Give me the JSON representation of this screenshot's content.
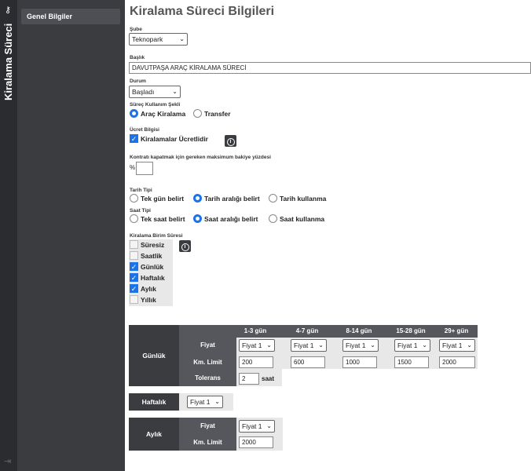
{
  "rail": {
    "title": "Kiralama Süreci"
  },
  "sidebar": {
    "items": [
      {
        "label": "Genel Bilgiler"
      }
    ]
  },
  "page": {
    "title": "Kiralama Süreci Bilgileri"
  },
  "sube": {
    "label": "Şube",
    "value": "Teknopark"
  },
  "baslik": {
    "label": "Başlık",
    "value": "DAVUTPAŞA ARAÇ KİRALAMA SÜRECİ"
  },
  "durum": {
    "label": "Durum",
    "value": "Başladı"
  },
  "kullanim": {
    "label": "Süreç Kullanım Şekli",
    "options": [
      "Araç Kiralama",
      "Transfer"
    ],
    "selected": "Araç Kiralama"
  },
  "ucret": {
    "label": "Ücret Bilgisi",
    "checkbox_label": "Kiralamalar Ücretlidir",
    "checked": true
  },
  "bakiye": {
    "label": "Kontratı kapatmak için gereken maksimum bakiye yüzdesi",
    "prefix": "%",
    "value": ""
  },
  "tarih": {
    "label": "Tarih Tipi",
    "options": [
      "Tek gün belirt",
      "Tarih aralığı belirt",
      "Tarih kullanma"
    ],
    "selected": "Tarih aralığı belirt"
  },
  "saat": {
    "label": "Saat Tipi",
    "options": [
      "Tek saat belirt",
      "Saat aralığı belirt",
      "Saat kullanma"
    ],
    "selected": "Saat aralığı belirt"
  },
  "birim": {
    "label": "Kiralama Birim Süresi",
    "items": [
      {
        "label": "Süresiz",
        "checked": false
      },
      {
        "label": "Saatlik",
        "checked": false
      },
      {
        "label": "Günlük",
        "checked": true
      },
      {
        "label": "Haftalık",
        "checked": true
      },
      {
        "label": "Aylık",
        "checked": true
      },
      {
        "label": "Yıllık",
        "checked": false
      }
    ]
  },
  "gunluk": {
    "title": "Günlük",
    "columns": [
      "1-3 gün",
      "4-7 gün",
      "8-14 gün",
      "15-28 gün",
      "29+ gün"
    ],
    "fiyat_label": "Fiyat",
    "fiyat": [
      "Fiyat 1",
      "Fiyat 1",
      "Fiyat 1",
      "Fiyat 1",
      "Fiyat 1"
    ],
    "km_label": "Km. Limit",
    "km": [
      "200",
      "600",
      "1000",
      "1500",
      "2000"
    ],
    "tolerans_label": "Tolerans",
    "tolerans": "2",
    "tolerans_unit": "saat"
  },
  "haftalik": {
    "title": "Haftalık",
    "fiyat": "Fiyat 1"
  },
  "aylik": {
    "title": "Aylık",
    "fiyat_label": "Fiyat",
    "fiyat": "Fiyat 1",
    "km_label": "Km. Limit",
    "km": "2000"
  }
}
